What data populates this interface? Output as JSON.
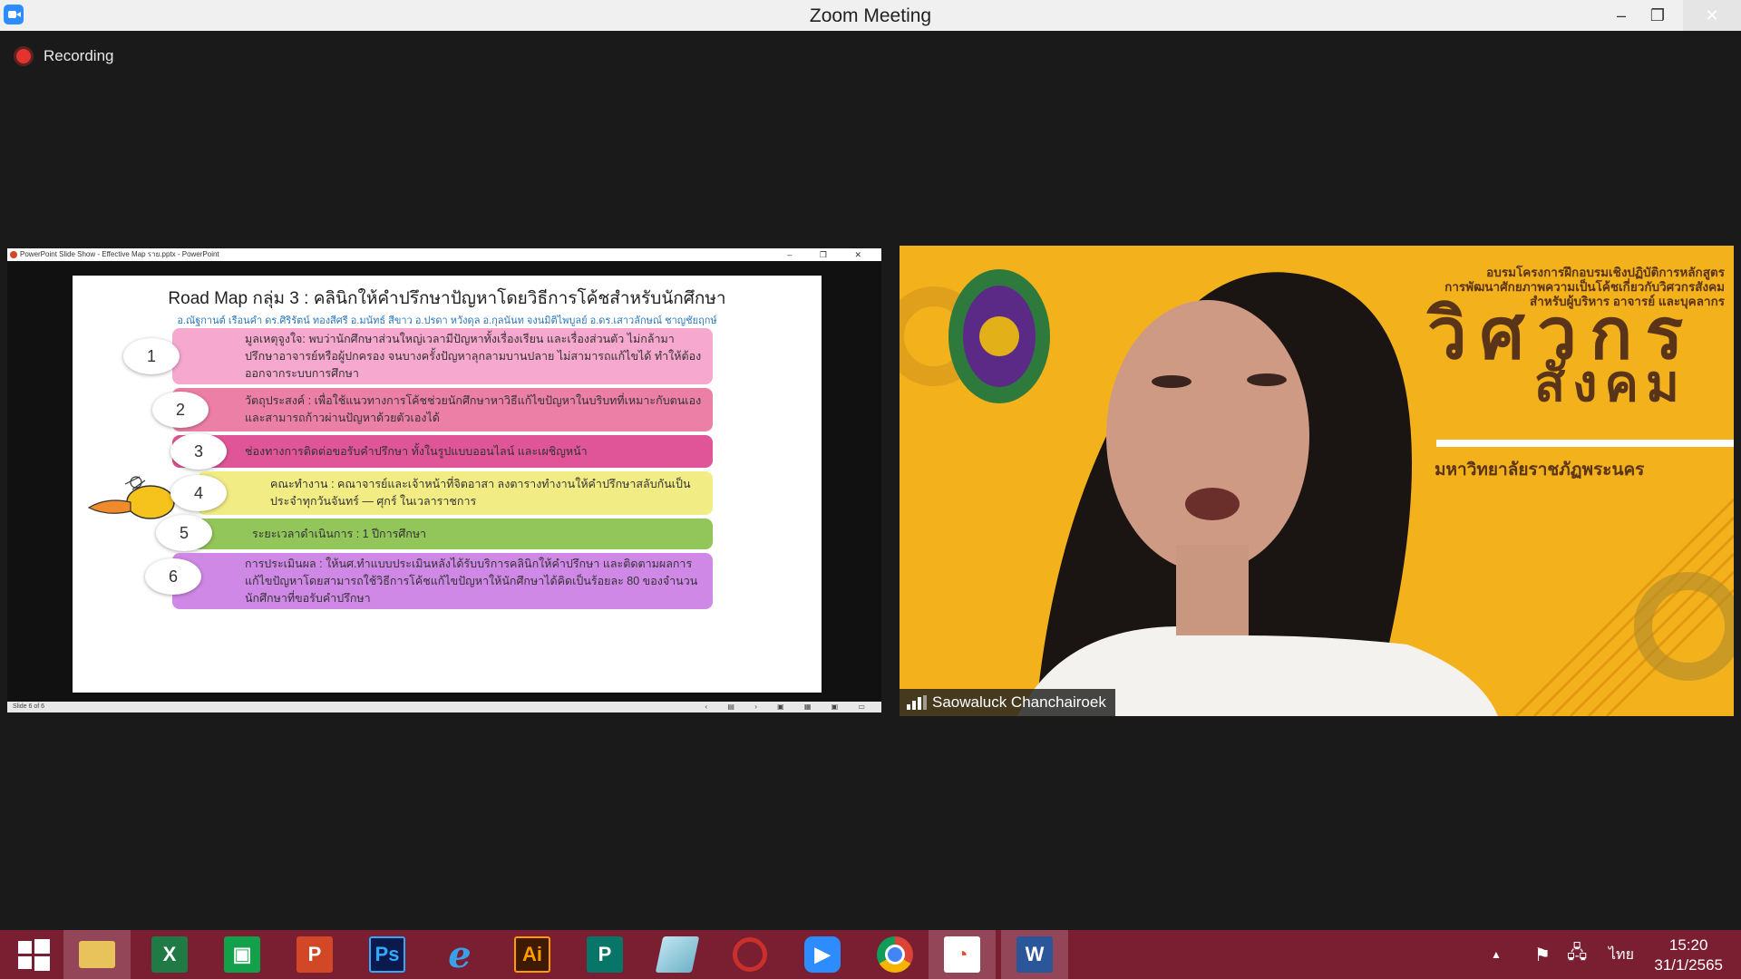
{
  "window": {
    "title": "Zoom Meeting"
  },
  "recording": {
    "label": "Recording"
  },
  "share": {
    "title_bar": "PowerPoint Slide Show  -  Effective  Map  ราย.pptx - PowerPoint",
    "status_left": "Slide 6 of 6",
    "slide": {
      "title": "Road  Map  กลุ่ม  3  :  คลินิกให้คำปรึกษาปัญหาโดยวิธีการโค้ชสำหรับนักศึกษา",
      "authors": "อ.ณัฐกานต์  เรือนคำ  ดร.ศิริรัตน์  ทองสีศรี  อ.มนัทธ์  สีขาว  อ.ปรดา  หวังดุล  อ.กุลนันท  จงนมิติไพบูลย์  อ.ดร.เสาวลักษณ์  ชาญชัยฤกษ์",
      "rows": [
        {
          "num": "1",
          "text": "มูลเหตุจูงใจ:  พบว่านักศึกษาส่วนใหญ่เวลามีปัญหาทั้งเรื่องเรียน  และเรื่องส่วนตัว  ไม่กล้ามาปรึกษาอาจารย์หรือผู้ปกครอง  จนบางครั้งปัญหาลุกลามบานปลาย  ไม่สามารถแก้ไขได้  ทำให้ต้องออกจากระบบการศึกษา"
        },
        {
          "num": "2",
          "text": "วัตถุประสงค์  :  เพื่อใช้แนวทางการโค้ชช่วยนักศึกษาหาวิธีแก้ไขปัญหาในบริบทที่เหมาะกับตนเองและสามารถก้าวผ่านปัญหาด้วยตัวเองได้"
        },
        {
          "num": "3",
          "text": "ช่องทางการติดต่อขอรับคำปรึกษา    ทั้งในรูปแบบออนไลน์  และเผชิญหน้า"
        },
        {
          "num": "4",
          "text": "คณะทำงาน  :  คณาจารย์และเจ้าหน้าที่จิตอาสา  ลงตารางทำงานให้คำปรึกษาสลับกันเป็นประจำทุกวันจันทร์  —  ศุกร์  ในเวลาราชการ"
        },
        {
          "num": "5",
          "text": "ระยะเวลาดำเนินการ  :  1  ปีการศึกษา"
        },
        {
          "num": "6",
          "text": "การประเมินผล  :  ให้นศ.ทำแบบประเมินหลังได้รับบริการคลินิกให้คำปรึกษา  และติดตามผลการแก้ไขปัญหาโดยสามารถใช้วิธีการโค้ชแก้ไขปัญหาให้นักศึกษาได้คิดเป็นร้อยละ  80  ของจำนวนนักศึกษาที่ขอรับคำปรึกษา"
        }
      ],
      "row_colors": [
        "#f7a8cf",
        "#ec7fa6",
        "#e05597",
        "#f2ec84",
        "#93c65a",
        "#d088e6"
      ]
    }
  },
  "video": {
    "participant": "Saowaluck Chanchairoek",
    "bg_lines": [
      "อบรมโครงการฝึกอบรมเชิงปฏิบัติการหลักสูตร",
      "การพัฒนาศักยภาพความเป็นโค้ชเกี่ยวกับวิศวกรสังคม",
      "สำหรับผู้บริหาร อาจารย์ และบุคลากร"
    ],
    "bg_title_1": "วิศวกร",
    "bg_title_2": "สังคม",
    "bg_university": "มหาวิทยาลัยราชภัฏพระนคร",
    "colors": {
      "bg": "#f3b21c",
      "brown": "#5a3418"
    }
  },
  "taskbar": {
    "apps": [
      {
        "name": "start",
        "glyph": "",
        "color": ""
      },
      {
        "name": "file-explorer",
        "glyph": "",
        "color": "#e8c25a"
      },
      {
        "name": "excel",
        "glyph": "X",
        "color": "#1f7a45"
      },
      {
        "name": "store",
        "glyph": "",
        "color": "#13a04b"
      },
      {
        "name": "powerpoint",
        "glyph": "P",
        "color": "#d24726"
      },
      {
        "name": "photoshop",
        "glyph": "Ps",
        "color": "#0b1a4d"
      },
      {
        "name": "internet-explorer",
        "glyph": "e",
        "color": ""
      },
      {
        "name": "illustrator",
        "glyph": "Ai",
        "color": "#3d1a00"
      },
      {
        "name": "publisher",
        "glyph": "P",
        "color": "#077568"
      },
      {
        "name": "notes",
        "glyph": "",
        "color": "#6fb3c9"
      },
      {
        "name": "hotocape",
        "glyph": "",
        "color": ""
      },
      {
        "name": "zoom",
        "glyph": "",
        "color": "#2d8cff"
      },
      {
        "name": "chrome",
        "glyph": "",
        "color": ""
      },
      {
        "name": "paint",
        "glyph": "",
        "color": "#ffffff"
      },
      {
        "name": "word",
        "glyph": "W",
        "color": "#2b579a"
      }
    ],
    "language": "ไทย",
    "time": "15:20",
    "date": "31/1/2565"
  }
}
